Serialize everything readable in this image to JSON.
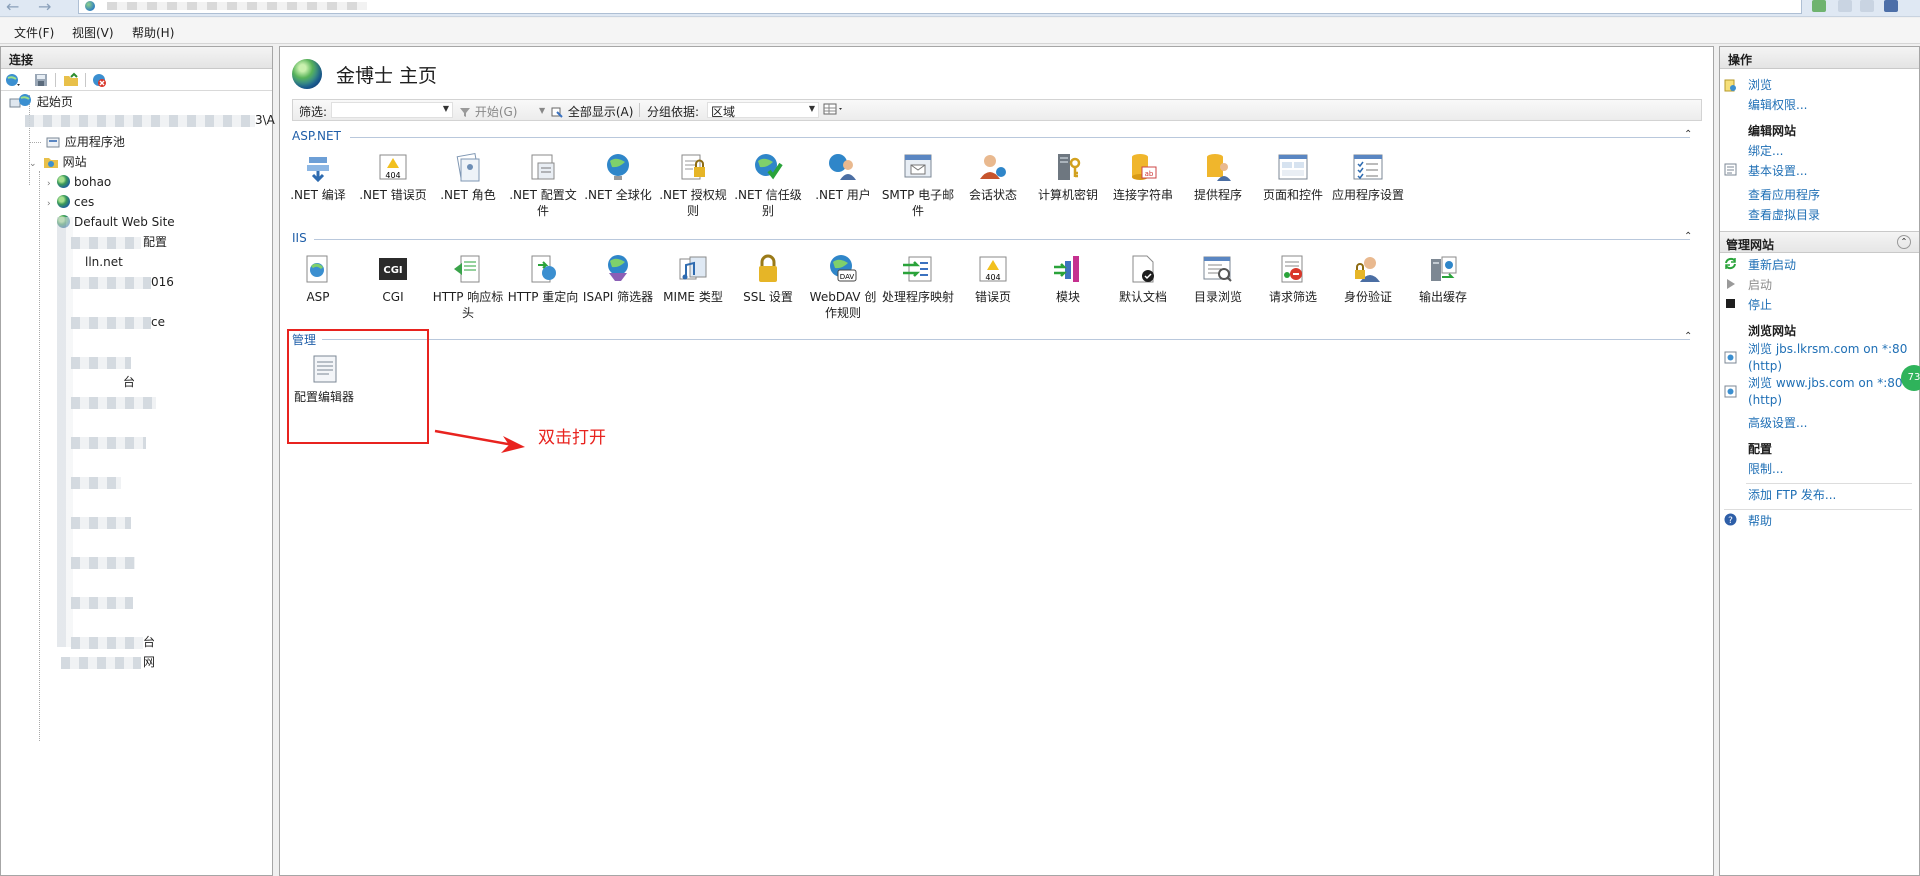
{
  "menu": {
    "file": "文件(F)",
    "view": "视图(V)",
    "help": "帮助(H)"
  },
  "left": {
    "header": "连接",
    "tree": {
      "start_page": "起始页",
      "app_pools": "应用程序池",
      "sites": "网站",
      "site1": "bohao",
      "site2": "ces",
      "site3": "Default Web Site",
      "partial1": "配置",
      "partial2": "lln.net",
      "partial3": "016",
      "partial4": "ce",
      "partial5": "台",
      "partial6": "网",
      "server_suffix": "3\\A"
    }
  },
  "main": {
    "title": "金博士 主页",
    "filter": {
      "filter_label": "筛选:",
      "start_label": "开始(G)",
      "show_all_label": "全部显示(A)",
      "group_label": "分组依据:",
      "group_value": "区域"
    },
    "sections": {
      "aspnet": "ASP.NET",
      "iis": "IIS",
      "manage": "管理"
    },
    "aspnet_features": [
      ".NET 编译",
      ".NET 错误页",
      ".NET 角色",
      ".NET 配置文件",
      ".NET 全球化",
      ".NET 授权规则",
      ".NET 信任级别",
      ".NET 用户",
      "SMTP 电子邮件",
      "会话状态",
      "计算机密钥",
      "连接字符串",
      "提供程序",
      "页面和控件",
      "应用程序设置"
    ],
    "iis_features": [
      "ASP",
      "CGI",
      "HTTP 响应标头",
      "HTTP 重定向",
      "ISAPI 筛选器",
      "MIME 类型",
      "SSL 设置",
      "WebDAV 创作规则",
      "处理程序映射",
      "错误页",
      "模块",
      "默认文档",
      "目录浏览",
      "请求筛选",
      "身份验证",
      "输出缓存"
    ],
    "manage_features": [
      "配置编辑器"
    ],
    "annotation": "双击打开",
    "icon_texts": {
      "err404": "404",
      "cgi": "CGI",
      "dav": "DAV"
    }
  },
  "right": {
    "header": "操作",
    "browse": "浏览",
    "edit_perms": "编辑权限...",
    "edit_site_head": "编辑网站",
    "bindings": "绑定...",
    "basic_settings": "基本设置...",
    "view_apps": "查看应用程序",
    "view_vdirs": "查看虚拟目录",
    "manage_site_head": "管理网站",
    "restart": "重新启动",
    "start": "启动",
    "stop": "停止",
    "browse_site_head": "浏览网站",
    "browse1a": "浏览 jbs.lkrsm.com on *:80",
    "browse1b": "(http)",
    "browse2a": "浏览 www.jbs.com on *:80",
    "browse2b": "(http)",
    "advanced": "高级设置...",
    "config_head": "配置",
    "limits": "限制...",
    "add_ftp": "添加 FTP 发布...",
    "help": "帮助",
    "badge": "73"
  },
  "colors": {
    "link": "#1f6fb5",
    "highlight": "#e8231f",
    "section": "#1f5ea8"
  }
}
